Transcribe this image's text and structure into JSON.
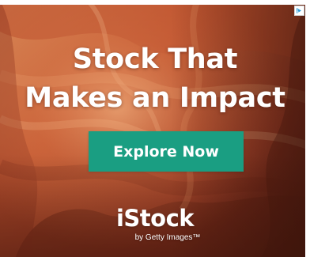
{
  "ad": {
    "headline_line1": "Stock That",
    "headline_line2": "Makes an Impact",
    "cta_label": "Explore Now",
    "logo_text": "iStock",
    "logo_subtext": "by Getty Images™",
    "background_image": "canyon-sandstone-waves",
    "adchoices_icon": "adchoices-icon"
  },
  "colors": {
    "cta_background": "#1a9e82",
    "text": "#ffffff",
    "canyon_orange": "#c2552f",
    "canyon_dark": "#4a1c13"
  }
}
